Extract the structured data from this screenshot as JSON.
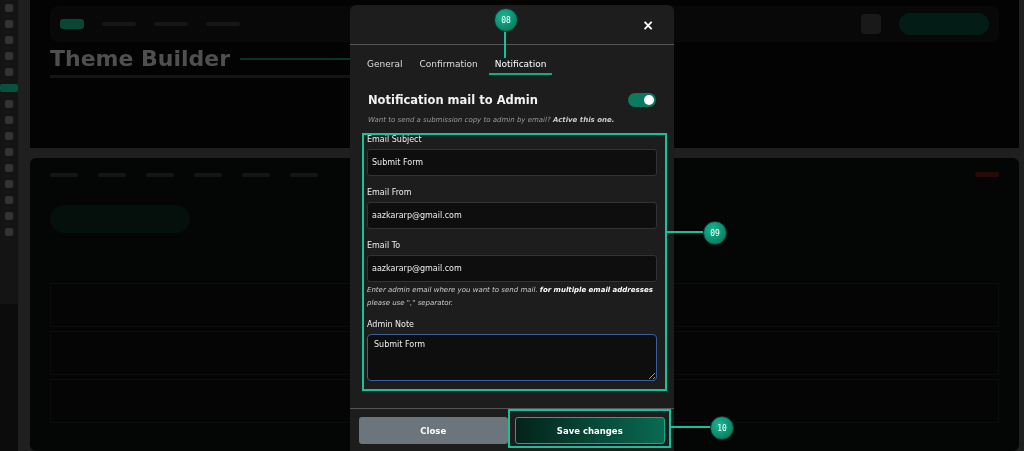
{
  "background": {
    "page_title": "Theme Builder"
  },
  "dialog": {
    "close": "×",
    "tabs": [
      {
        "label": "General",
        "selected": false
      },
      {
        "label": "Confirmation",
        "selected": false
      },
      {
        "label": "Notification",
        "selected": true
      }
    ],
    "section_title": "Notification mail to Admin",
    "toggle": {
      "on": true
    },
    "hint": "Want to send a submission copy to admin by email? **Active this one.**",
    "fields": [
      {
        "kind": "input",
        "label": "Email Subject",
        "value": "Submit Form"
      },
      {
        "kind": "input",
        "label": "Email From",
        "value": "aazkararp@gmail.com"
      },
      {
        "kind": "input",
        "label": "Email To",
        "value": "aazkararp@gmail.com",
        "help": "Enter admin email where you want to send mail. **for multiple email addresses** please use \",\" separator."
      },
      {
        "kind": "textarea",
        "label": "Admin Note",
        "value": "Submit Form"
      }
    ],
    "buttons": [
      {
        "kind": "secondary",
        "label": "Close"
      },
      {
        "kind": "primary",
        "label": "Save changes"
      }
    ]
  },
  "callouts": [
    {
      "kind": "tabs",
      "label": "08"
    },
    {
      "kind": "fields",
      "label": "09"
    },
    {
      "kind": "save",
      "label": "10"
    }
  ]
}
